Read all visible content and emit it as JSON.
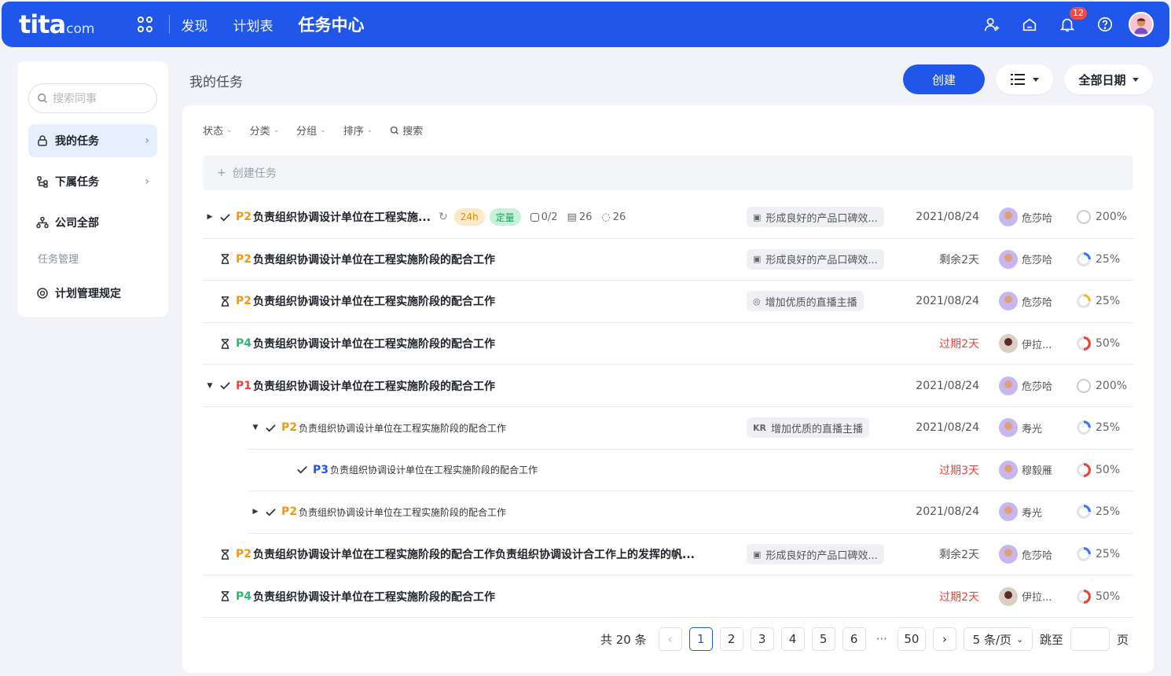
{
  "header": {
    "logo_main": "tita",
    "logo_suffix": "com",
    "nav": [
      "发现",
      "计划表",
      "任务中心"
    ],
    "notification_count": "12"
  },
  "sidebar": {
    "search_placeholder": "搜索同事",
    "items": [
      {
        "label": "我的任务",
        "icon": "lock-icon"
      },
      {
        "label": "下属任务",
        "icon": "hierarchy-icon"
      },
      {
        "label": "公司全部",
        "icon": "org-icon"
      }
    ],
    "group_label": "任务管理",
    "rules_label": "计划管理规定"
  },
  "main": {
    "title": "我的任务",
    "create_label": "创建",
    "date_filter": "全部日期",
    "filters": [
      "状态",
      "分类",
      "分组",
      "排序"
    ],
    "search_label": "搜索",
    "new_task_label": "创建任务"
  },
  "tasks": [
    {
      "prio": "P2",
      "name": "负责组织协调设计单位在工程实施...",
      "tag1": "24h",
      "tag2": "定量",
      "sub": "0/2",
      "files": "26",
      "comments": "26",
      "okr": "形成良好的产品口碑效...",
      "date": "2021/08/24",
      "person": "危莎哈",
      "progress": "200%"
    },
    {
      "prio": "P2",
      "name": "负责组织协调设计单位在工程实施阶段的配合工作",
      "okr": "形成良好的产品口碑效...",
      "date": "剩余2天",
      "person": "危莎哈",
      "progress": "25%"
    },
    {
      "prio": "P2",
      "name": "负责组织协调设计单位在工程实施阶段的配合工作",
      "okr": "增加优质的直播主播",
      "date": "2021/08/24",
      "person": "危莎哈",
      "progress": "25%"
    },
    {
      "prio": "P4",
      "name": "负责组织协调设计单位在工程实施阶段的配合工作",
      "date": "过期2天",
      "person": "伊拉...",
      "progress": "50%"
    },
    {
      "prio": "P1",
      "name": "负责组织协调设计单位在工程实施阶段的配合工作",
      "date": "2021/08/24",
      "person": "危莎哈",
      "progress": "200%"
    },
    {
      "prio": "P2",
      "name": "负责组织协调设计单位在工程实施阶段的配合工作",
      "okr_prefix": "KR",
      "okr": "增加优质的直播主播",
      "date": "2021/08/24",
      "person": "寿光",
      "progress": "25%"
    },
    {
      "prio": "P3",
      "name": "负责组织协调设计单位在工程实施阶段的配合工作",
      "date": "过期3天",
      "person": "穆毅雁",
      "progress": "50%"
    },
    {
      "prio": "P2",
      "name": "负责组织协调设计单位在工程实施阶段的配合工作",
      "date": "2021/08/24",
      "person": "寿光",
      "progress": "25%"
    },
    {
      "prio": "P2",
      "name": "负责组织协调设计单位在工程实施阶段的配合工作负责组织协调设计合工作上的发挥的帆...",
      "okr": "形成良好的产品口碑效...",
      "date": "剩余2天",
      "person": "危莎哈",
      "progress": "25%"
    },
    {
      "prio": "P4",
      "name": "负责组织协调设计单位在工程实施阶段的配合工作",
      "date": "过期2天",
      "person": "伊拉...",
      "progress": "50%"
    }
  ],
  "pagination": {
    "total": "共 20 条",
    "pages": [
      "1",
      "2",
      "3",
      "4",
      "5",
      "6"
    ],
    "ellipsis": "···",
    "last": "50",
    "page_size": "5 条/页",
    "jump_label": "跳至",
    "page_unit": "页"
  },
  "colors": {
    "brand": "#2056ea",
    "overdue": "#e8443a",
    "p1": "#e8443a",
    "p2": "#f09a0e",
    "p3": "#2056ea",
    "p4": "#2db970"
  }
}
